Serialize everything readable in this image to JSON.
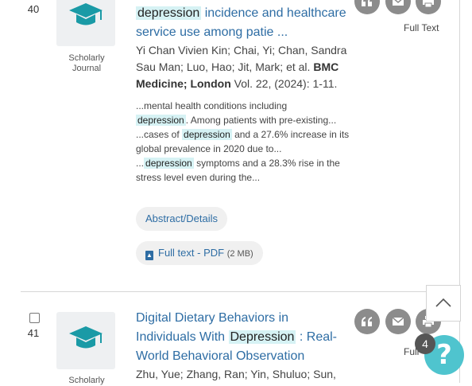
{
  "results": [
    {
      "number": "40",
      "type_label": "Scholarly Journal",
      "title_pre": "",
      "title_highlight": "depression",
      "title_post": " incidence and healthcare service use among patie ...",
      "authors": "Yi Chan Vivien Kin; Chai, Yi; Chan, Sandra Sau Man; Luo, Hao; Jit, Mark; et al.",
      "journal": "BMC Medicine; London",
      "citation": " Vol. 22,  (2024): 1-11.",
      "snippet_1_pre": "...mental health conditions including",
      "snippet_1_hl": "depression",
      "snippet_1_post": ". Among patients with pre-existing...",
      "snippet_2_pre": "...cases of ",
      "snippet_2_hl": "depression",
      "snippet_2_post": " and a 27.6% increase in its global prevalence in 2020 due to...",
      "snippet_3_pre": "...",
      "snippet_3_hl": "depression",
      "snippet_3_post": " symptoms and a 28.3% rise in the stress level even during the...",
      "abstract_label": "Abstract/Details",
      "fulltext_pdf_label": "Full text - PDF",
      "fulltext_pdf_size": "(2 MB)",
      "fulltext_label": "Full Text"
    },
    {
      "number": "41",
      "type_label": "Scholarly",
      "title_pre": "Digital Dietary Behaviors in Individuals With ",
      "title_highlight": "Depression",
      "title_post": " : Real-World Behavioral Observation",
      "authors": "Zhu, Yue; Zhang, Ran; Yin, Shuluo; Sun,",
      "fulltext_label": "Full"
    }
  ],
  "notification_count": "4",
  "help_symbol": "?",
  "icons": {
    "cite": "quote-icon",
    "email": "envelope-icon",
    "print": "printer-icon",
    "journal": "graduation-cap-icon",
    "pdf": "pdf-icon",
    "scroll": "chevron-up-icon"
  },
  "colors": {
    "link": "#2e6da4",
    "highlight": "#d6f2f4",
    "help": "#4fc4ce",
    "action_icon": "#8c8c8c"
  }
}
